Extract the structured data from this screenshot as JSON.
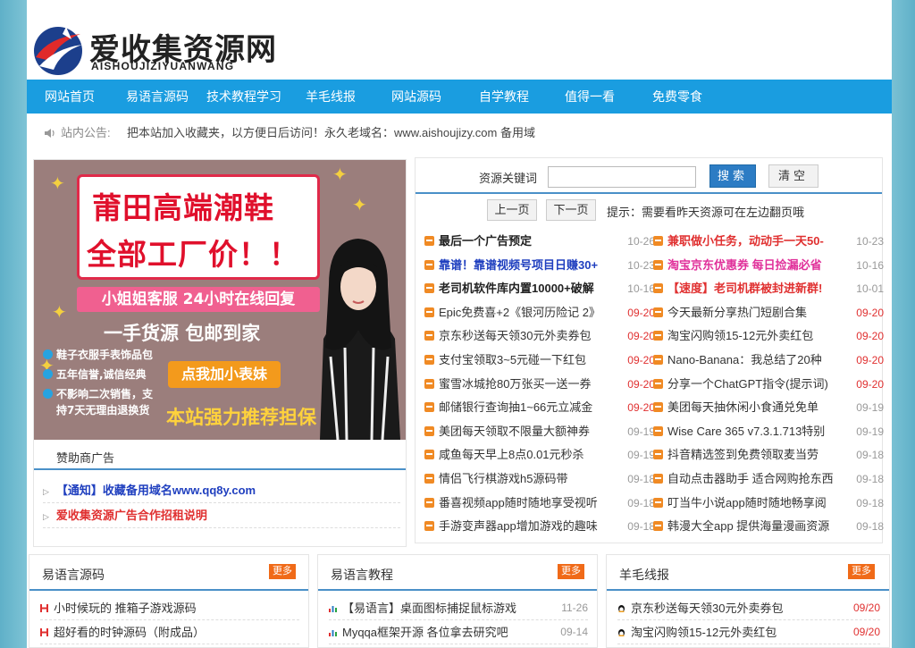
{
  "colors": {
    "nav": "#1a9de0",
    "accent_blue": "#2c7cc4",
    "red": "#e03030",
    "more_orange": "#f06a18"
  },
  "logo": {
    "title": "爱收集资源网",
    "subtitle": "AISHOUJIZIYUANWANG",
    "icon": "logo-mark-icon"
  },
  "nav": [
    "网站首页",
    "易语言源码",
    "技术教程学习",
    "羊毛线报",
    "网站源码",
    "自学教程",
    "值得一看",
    "免费零食"
  ],
  "notice": {
    "label": "站内公告:",
    "text": "把本站加入收藏夹，以方便日后访问！永久老域名：www.aishoujizy.com 备用域"
  },
  "ad": {
    "title_line1": "莆田高端潮鞋",
    "title_line2": "全部工厂价！！",
    "service": "小姐姐客服 24小时在线回复",
    "sub": "一手货源 包邮到家",
    "features": [
      "鞋子衣服手表饰品包",
      "五年信誉,诚信经典",
      "不影响二次销售，支",
      "持7天无理由退换货"
    ],
    "button": "点我加小表妹",
    "recommend": "本站强力推荐担保"
  },
  "sponsor": {
    "title": "赞助商广告",
    "links": [
      {
        "text": "【通知】收藏备用域名www.qq8y.com",
        "color": "#1f3fbf"
      },
      {
        "text": "爱收集资源广告合作招租说明",
        "color": "#e03030"
      }
    ]
  },
  "search": {
    "label": "资源关键词",
    "placeholder": "",
    "search_btn": "搜索",
    "clear_btn": "清空"
  },
  "pager": {
    "prev": "上一页",
    "next": "下一页",
    "hint": "提示：需要看昨天资源可在左边翻页哦"
  },
  "resources_left": [
    {
      "title": "最后一个广告预定",
      "date": "10-26",
      "color": "#222",
      "bold": true,
      "red": false
    },
    {
      "title": "靠谱！靠谱视频号项目日赚30+",
      "date": "10-23",
      "color": "#1f3fbf",
      "bold": true,
      "red": false
    },
    {
      "title": "老司机软件库内置10000+破解",
      "date": "10-16",
      "color": "#222",
      "bold": true,
      "red": false
    },
    {
      "title": "Epic免费喜+2《银河历险记 2》",
      "date": "09-20",
      "color": "#333",
      "bold": false,
      "red": true
    },
    {
      "title": "京东秒送每天领30元外卖券包",
      "date": "09-20",
      "color": "#333",
      "bold": false,
      "red": true
    },
    {
      "title": "支付宝领取3~5元碰一下红包",
      "date": "09-20",
      "color": "#333",
      "bold": false,
      "red": true
    },
    {
      "title": "蜜雪冰城抢80万张买一送一券",
      "date": "09-20",
      "color": "#333",
      "bold": false,
      "red": true
    },
    {
      "title": "邮储银行查询抽1~66元立减金",
      "date": "09-20",
      "color": "#333",
      "bold": false,
      "red": true
    },
    {
      "title": "美团每天领取不限量大额神券",
      "date": "09-19",
      "color": "#333",
      "bold": false,
      "red": false
    },
    {
      "title": "咸鱼每天早上8点0.01元秒杀",
      "date": "09-19",
      "color": "#333",
      "bold": false,
      "red": false
    },
    {
      "title": "情侣飞行棋游戏h5源码带",
      "date": "09-18",
      "color": "#333",
      "bold": false,
      "red": false
    },
    {
      "title": "番喜视频app随时随地享受视听",
      "date": "09-18",
      "color": "#333",
      "bold": false,
      "red": false
    },
    {
      "title": "手游变声器app增加游戏的趣味",
      "date": "09-18",
      "color": "#333",
      "bold": false,
      "red": false
    }
  ],
  "resources_right": [
    {
      "title": "兼职做小任务，动动手一天50-",
      "date": "10-23",
      "color": "#e03030",
      "bold": true,
      "red": false
    },
    {
      "title": "淘宝京东优惠券 每日捡漏必省",
      "date": "10-16",
      "color": "#e0309a",
      "bold": true,
      "red": false
    },
    {
      "title": "【速度】老司机群被封进新群!",
      "date": "10-01",
      "color": "#e03030",
      "bold": true,
      "red": false
    },
    {
      "title": "今天最新分享热门短剧合集",
      "date": "09-20",
      "color": "#333",
      "bold": false,
      "red": true
    },
    {
      "title": "淘宝闪购领15-12元外卖红包",
      "date": "09-20",
      "color": "#333",
      "bold": false,
      "red": true
    },
    {
      "title": "Nano-Banana：我总结了20种",
      "date": "09-20",
      "color": "#333",
      "bold": false,
      "red": true
    },
    {
      "title": "分享一个ChatGPT指令(提示词)",
      "date": "09-20",
      "color": "#333",
      "bold": false,
      "red": true
    },
    {
      "title": "美团每天抽休闲小食通兑免单",
      "date": "09-19",
      "color": "#333",
      "bold": false,
      "red": false
    },
    {
      "title": "Wise Care 365 v7.3.1.713特别",
      "date": "09-19",
      "color": "#333",
      "bold": false,
      "red": false
    },
    {
      "title": "抖音精选签到免费领取麦当劳",
      "date": "09-18",
      "color": "#333",
      "bold": false,
      "red": false
    },
    {
      "title": "自动点击器助手 适合网购抢东西",
      "date": "09-18",
      "color": "#333",
      "bold": false,
      "red": false
    },
    {
      "title": "叮当牛小说app随时随地畅享阅",
      "date": "09-18",
      "color": "#333",
      "bold": false,
      "red": false
    },
    {
      "title": "韩漫大全app 提供海量漫画资源",
      "date": "09-18",
      "color": "#333",
      "bold": false,
      "red": false
    }
  ],
  "cards": [
    {
      "title": "易语言源码",
      "more": "更多",
      "items": [
        {
          "text": "小时候玩的 推箱子游戏源码",
          "date": ""
        },
        {
          "text": "超好看的时钟源码（附成品）",
          "date": ""
        }
      ]
    },
    {
      "title": "易语言教程",
      "more": "更多",
      "items": [
        {
          "text": "【易语言】桌面图标捕捉鼠标游戏",
          "date": "11-26"
        },
        {
          "text": "Myqqa框架开源 各位拿去研究吧",
          "date": "09-14"
        }
      ]
    },
    {
      "title": "羊毛线报",
      "more": "更多",
      "items": [
        {
          "text": "京东秒送每天领30元外卖券包",
          "date": "09/20"
        },
        {
          "text": "淘宝闪购领15-12元外卖红包",
          "date": "09/20"
        }
      ]
    }
  ]
}
